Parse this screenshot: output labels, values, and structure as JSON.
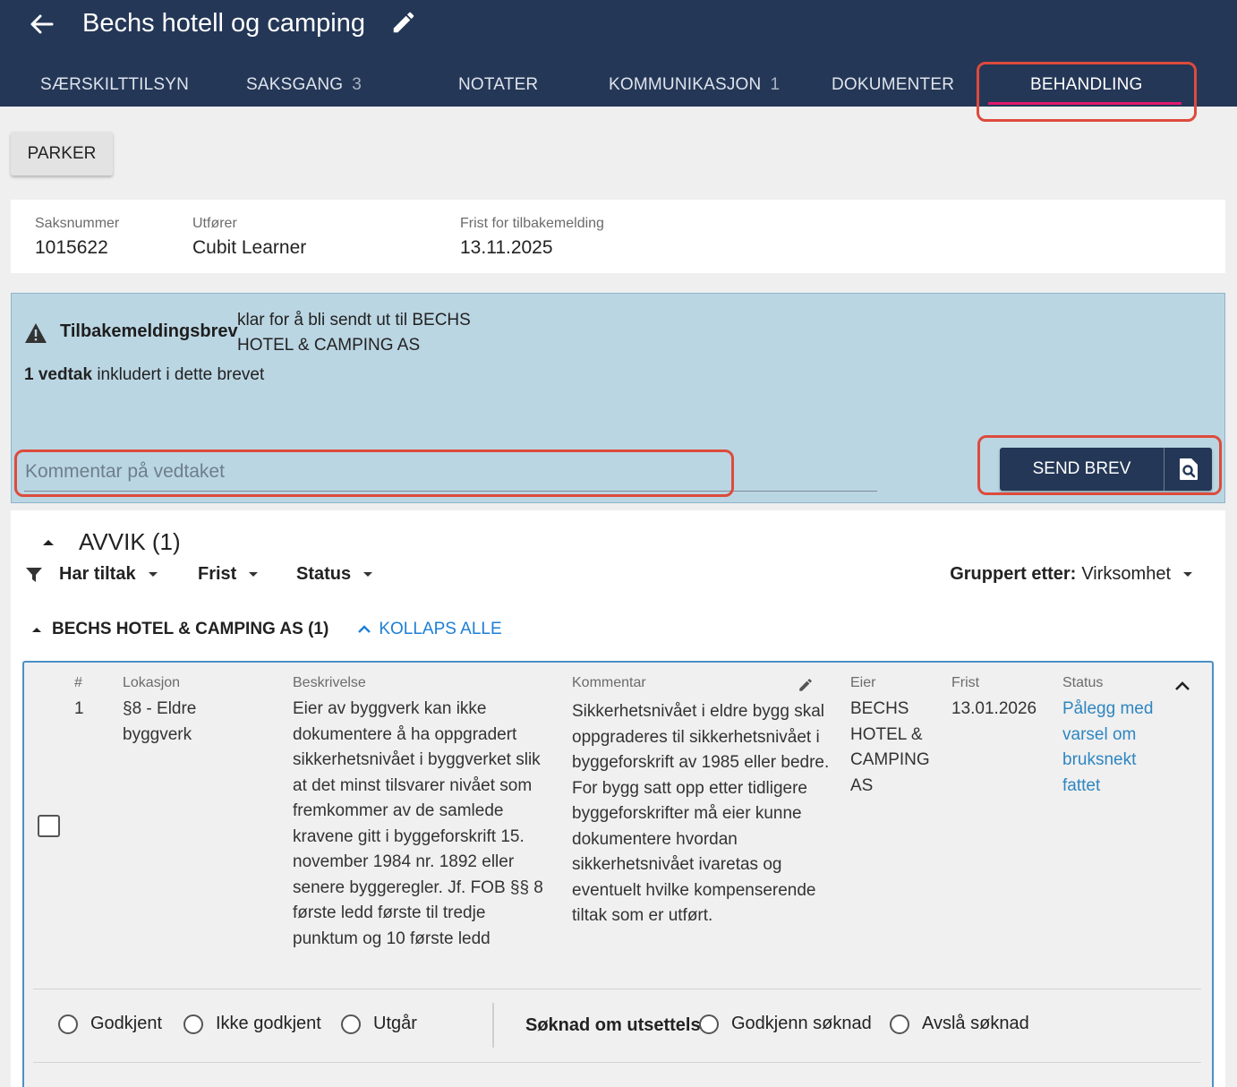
{
  "header": {
    "title": "Bechs hotell og camping",
    "tabs": [
      {
        "label": "SÆRSKILTTILSYN",
        "count": ""
      },
      {
        "label": "SAKSGANG",
        "count": "3"
      },
      {
        "label": "NOTATER",
        "count": ""
      },
      {
        "label": "KOMMUNIKASJON",
        "count": "1"
      },
      {
        "label": "DOKUMENTER",
        "count": ""
      },
      {
        "label": "BEHANDLING",
        "count": ""
      }
    ],
    "active_tab": "BEHANDLING"
  },
  "actions": {
    "parker_label": "PARKER"
  },
  "case_info": {
    "saksnummer_label": "Saksnummer",
    "saksnummer": "1015622",
    "utforer_label": "Utfører",
    "utforer": "Cubit Learner",
    "frist_label": "Frist for tilbakemelding",
    "frist": "13.11.2025"
  },
  "letter": {
    "title": "Tilbakemeldingsbrev",
    "message": "klar for å bli sendt ut til BECHS HOTEL & CAMPING AS",
    "vedtak_count": "1 vedtak",
    "vedtak_text": "inkludert i dette brevet",
    "comment_placeholder": "Kommentar på vedtaket",
    "send_label": "SEND BREV"
  },
  "avvik": {
    "title": "AVVIK (1)",
    "filters": [
      "Har tiltak",
      "Frist",
      "Status"
    ],
    "group_by_label": "Gruppert etter:",
    "group_by_value": "Virksomhet",
    "company": "BECHS HOTEL & CAMPING AS (1)",
    "collapse_all": "KOLLAPS ALLE",
    "columns": {
      "num": "#",
      "lokasjon": "Lokasjon",
      "beskrivelse": "Beskrivelse",
      "kommentar": "Kommentar",
      "eier": "Eier",
      "frist": "Frist",
      "status": "Status"
    },
    "row": {
      "num": "1",
      "lokasjon": "§8 - Eldre byggverk",
      "beskrivelse": "Eier av byggverk kan ikke dokumentere å ha oppgradert sikkerhetsnivået i byggverket slik at det minst tilsvarer nivået som fremkommer av de samlede kravene gitt i byggeforskrift 15. november 1984 nr. 1892 eller senere byggeregler. Jf. FOB §§ 8 første ledd første til tredje punktum og 10 første ledd",
      "kommentar": "Sikkerhetsnivået i eldre bygg skal oppgraderes til sikkerhetsnivået i byggeforskrift av 1985 eller bedre. For bygg satt opp etter tidligere byggeforskrifter må eier kunne dokumentere hvordan sikkerhetsnivået ivaretas og eventuelt hvilke kompenserende tiltak som er utført.",
      "eier": "BECHS HOTEL & CAMPING AS",
      "frist": "13.01.2026",
      "status": "Pålegg med varsel om bruksnekt fattet"
    },
    "decision_options": [
      "Godkjent",
      "Ikke godkjent",
      "Utgår"
    ],
    "soknad_label": "Søknad om utsettelse:",
    "soknad_options": [
      "Godkjenn søknad",
      "Avslå søknad"
    ]
  },
  "colors": {
    "header_bg": "#243757",
    "active_tab_underline": "#e2176e",
    "letter_bg": "#bbd6e3",
    "link": "#1c7fd6",
    "annotation": "#dd4b3c"
  }
}
